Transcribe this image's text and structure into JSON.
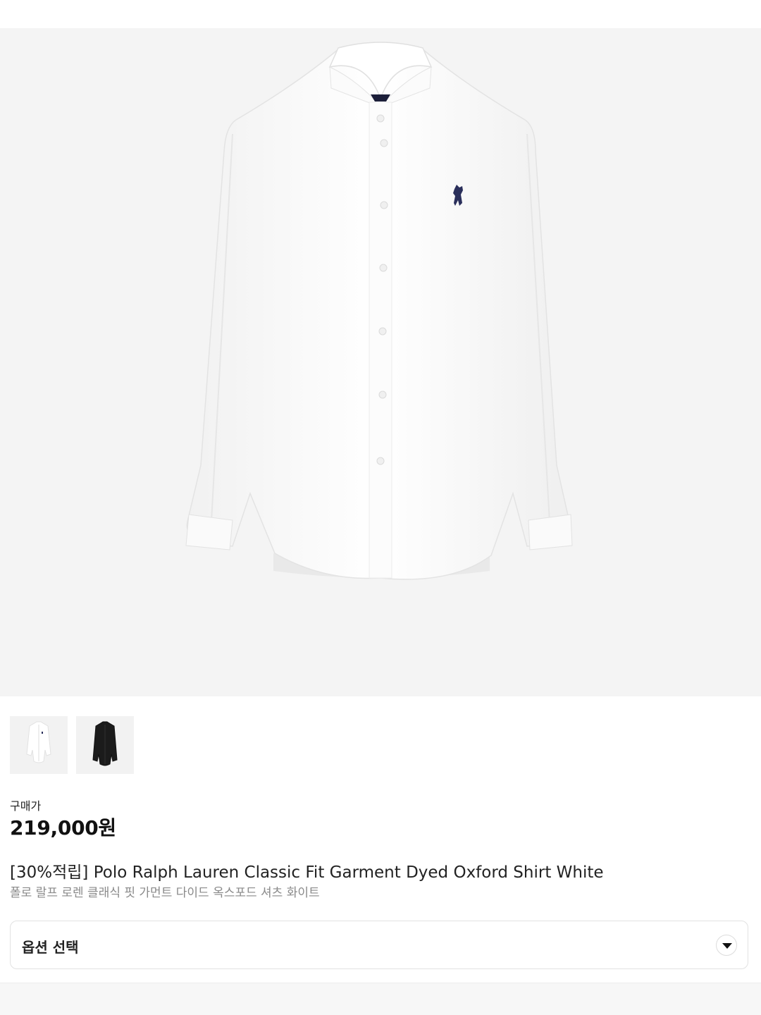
{
  "product": {
    "images": [
      {
        "alt": "white shirt",
        "color": "#ffffff"
      },
      {
        "alt": "black shirt",
        "color": "#1b1b1b"
      }
    ],
    "price_label": "구매가",
    "price": "219,000원",
    "title": "[30%적립] Polo Ralph Lauren Classic Fit Garment Dyed Oxford Shirt White",
    "subtitle": "폴로 랄프 로렌 클래식 핏 가먼트 다이드 옥스포드 셔츠 화이트"
  },
  "options": {
    "label": "옵션 선택",
    "icon": "chevron-down-icon"
  },
  "colors": {
    "image_bg": "#f4f4f4",
    "logo": "#2a2f5b"
  }
}
